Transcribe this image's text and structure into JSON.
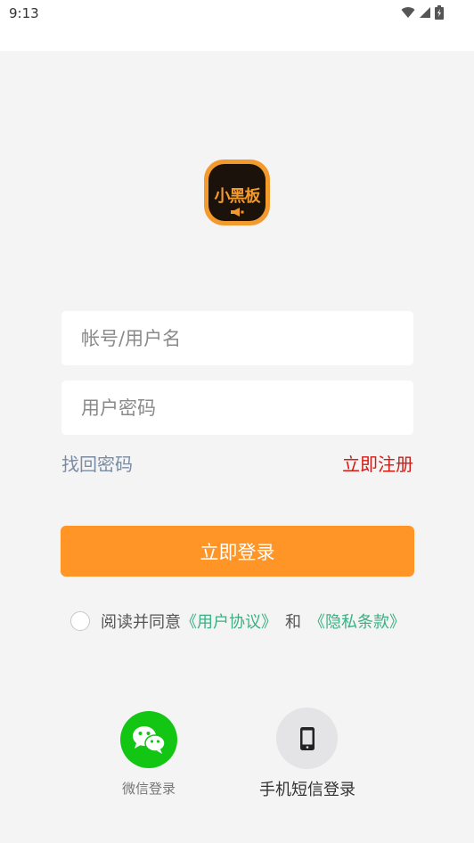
{
  "status_bar": {
    "time": "9:13",
    "icons": [
      "wifi-icon",
      "signal-icon",
      "battery-icon"
    ]
  },
  "logo": {
    "text": "小黑板",
    "icon": "megaphone-icon",
    "colors": {
      "border": "#f39a2e",
      "background": "#1b120b"
    }
  },
  "login_form": {
    "username_placeholder": "帐号/用户名",
    "password_placeholder": "用户密码",
    "forgot_password": "找回密码",
    "register": "立即注册",
    "submit_label": "立即登录"
  },
  "agreement": {
    "prefix": "阅读并同意",
    "user_agreement": "《用户协议》",
    "separator": "和",
    "privacy_policy": "《隐私条款》",
    "checked": false
  },
  "alt_login": {
    "wechat_label": "微信登录",
    "sms_label": "手机短信登录"
  },
  "colors": {
    "accent": "#ff9526",
    "register_link": "#d51a14",
    "agreement_link": "#3bb083",
    "wechat": "#14c614"
  }
}
